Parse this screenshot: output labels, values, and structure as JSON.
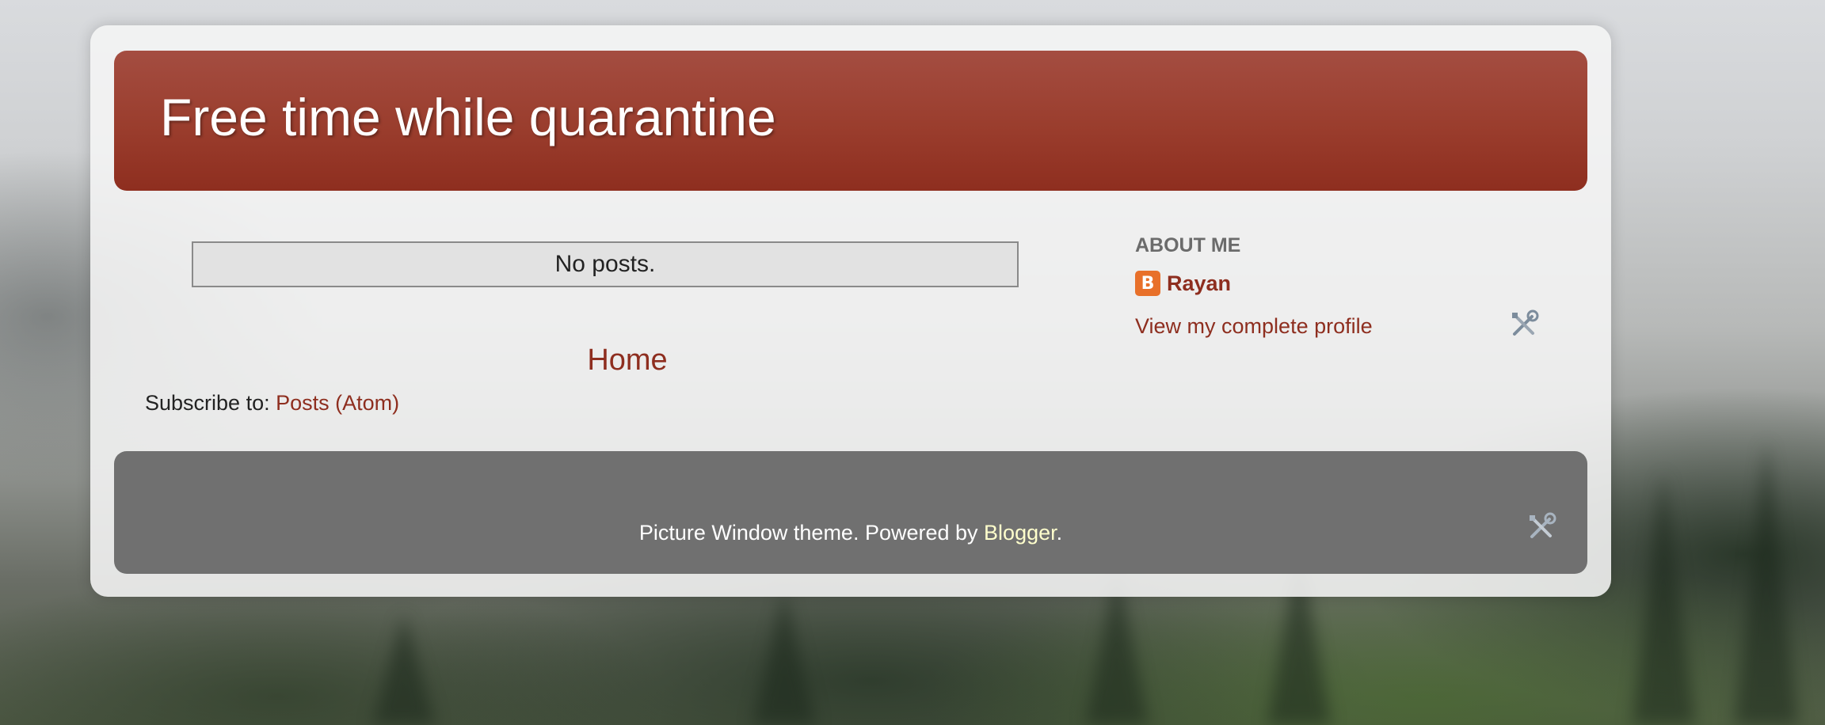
{
  "header": {
    "title": "Free time while quarantine"
  },
  "main": {
    "status_message": "No posts.",
    "home_link": "Home",
    "subscribe_label": "Subscribe to: ",
    "subscribe_link": "Posts (Atom)"
  },
  "sidebar": {
    "about_heading": "About Me",
    "profile_name": "Rayan",
    "profile_link": "View my complete profile",
    "profile_icon": "blogger-icon",
    "edit_icon": "wrench-screwdriver-icon"
  },
  "footer": {
    "text_prefix": "Picture Window theme. Powered by ",
    "blogger_link": "Blogger",
    "text_suffix": ".",
    "edit_icon": "wrench-screwdriver-icon"
  }
}
